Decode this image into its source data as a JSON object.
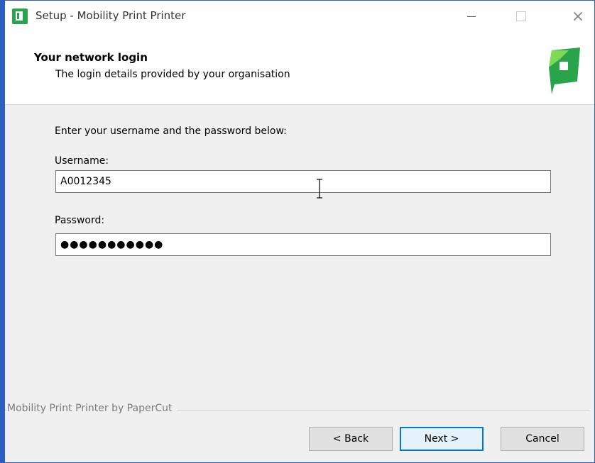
{
  "window": {
    "title": "Setup - Mobility Print Printer",
    "close_glyph": "×"
  },
  "header": {
    "title": "Your network login",
    "subtitle": "The login details provided by your organisation",
    "logo": "papercut-logo"
  },
  "form": {
    "intro": "Enter your username and the password below:",
    "username_label": "Username:",
    "username_value": "A0012345",
    "password_label": "Password:",
    "password_value": "●●●●●●●●●●●"
  },
  "footer": {
    "brand_text": "Mobility Print Printer by PaperCut"
  },
  "buttons": {
    "back": "< Back",
    "next": "Next >",
    "cancel": "Cancel"
  },
  "colors": {
    "accent": "#0078d7",
    "brand_green": "#2aa44a",
    "window_border": "#2b5fc1"
  }
}
